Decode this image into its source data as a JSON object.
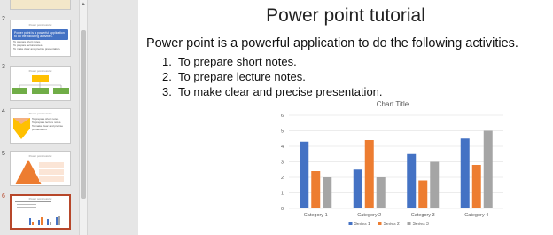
{
  "thumbnails": [
    {
      "number": "2",
      "title": "Power point tutorial",
      "blue_text": "Power point is a powerful application to do the following activities.",
      "lines": [
        "To prepare short notes.",
        "To prepare lecture notes.",
        "To make clear and precise presentation."
      ]
    },
    {
      "number": "3",
      "title": "Power point tutorial"
    },
    {
      "number": "4",
      "title": "Power point tutorial",
      "lines": [
        "To prepare short notes.",
        "To prepare lecture notes.",
        "To make clear and precise presentation."
      ]
    },
    {
      "number": "5",
      "title": "Power point tutorial"
    },
    {
      "number": "6",
      "title": "Power point tutorial"
    }
  ],
  "slide": {
    "title": "Power point tutorial",
    "intro": "Power point is a powerful application to do the following activities.",
    "items": [
      {
        "number": "1.",
        "text": "To prepare short notes."
      },
      {
        "number": "2.",
        "text": "To prepare lecture notes."
      },
      {
        "number": "3.",
        "text": "To make clear and precise presentation."
      }
    ]
  },
  "chart_data": {
    "type": "bar",
    "title": "Chart Title",
    "categories": [
      "Category 1",
      "Category 2",
      "Category 3",
      "Category 4"
    ],
    "series": [
      {
        "name": "Series 1",
        "color": "#4472c4",
        "values": [
          4.3,
          2.5,
          3.5,
          4.5
        ]
      },
      {
        "name": "Series 2",
        "color": "#ed7d31",
        "values": [
          2.4,
          4.4,
          1.8,
          2.8
        ]
      },
      {
        "name": "Series 3",
        "color": "#a5a5a5",
        "values": [
          2,
          2,
          3,
          5
        ]
      }
    ],
    "ylim": [
      0,
      6
    ],
    "yticks": [
      "0",
      "1",
      "2",
      "3",
      "4",
      "5",
      "6"
    ],
    "grid": true,
    "legend": "bottom"
  }
}
